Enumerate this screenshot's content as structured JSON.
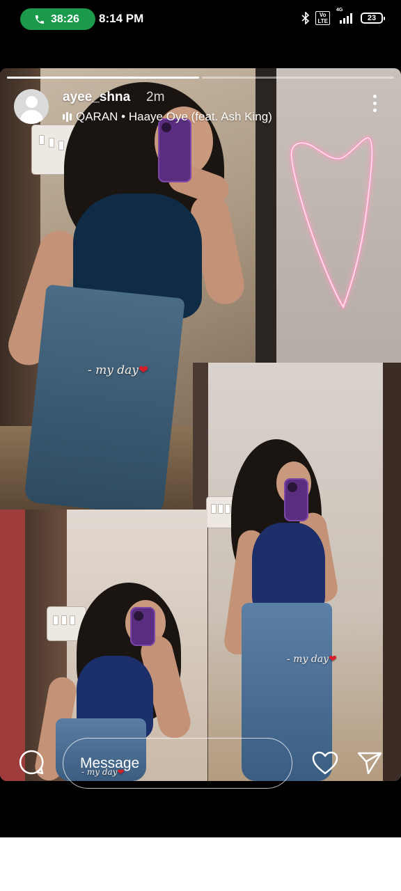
{
  "status_bar": {
    "call_timer": "38:26",
    "clock": "8:14 PM",
    "network": "4G",
    "volte": "Vo LTE",
    "battery": "23",
    "icons": [
      "phone-icon",
      "bluetooth-icon",
      "signal-icon",
      "battery-icon"
    ]
  },
  "story": {
    "progress_segments": [
      1.0,
      0.0
    ],
    "username": "ayee_shna",
    "time_ago": "2m",
    "music": "QARAN • Haaye Oye (feat. Ash King)",
    "captions": [
      "- my day",
      "- my day",
      "- my day"
    ],
    "caption_heart": "❤",
    "colors": {
      "call_pill": "#1b9a4b",
      "neon_heart": "#ff9fc4",
      "caption_heart": "#d61f2c"
    }
  },
  "bottom_bar": {
    "message_placeholder": "Message",
    "icons": [
      "comment-icon",
      "heart-icon",
      "send-icon"
    ]
  }
}
